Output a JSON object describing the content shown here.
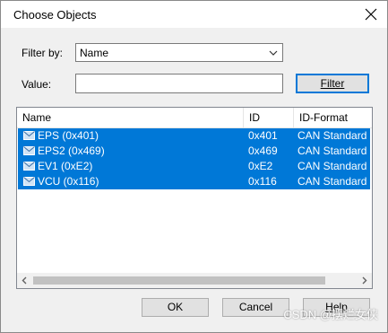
{
  "dialog": {
    "title": "Choose Objects",
    "close_icon": "close-icon"
  },
  "filter": {
    "filter_by_label": "Filter by:",
    "filter_by_value": "Name",
    "value_label": "Value:",
    "value_text": "",
    "filter_button": "Filter"
  },
  "table": {
    "columns": [
      "Name",
      "ID",
      "ID-Format"
    ],
    "rows": [
      {
        "name": "EPS (0x401)",
        "id": "0x401",
        "format": "CAN Standard",
        "icon": "message-icon"
      },
      {
        "name": "EPS2 (0x469)",
        "id": "0x469",
        "format": "CAN Standard",
        "icon": "message-icon"
      },
      {
        "name": "EV1 (0xE2)",
        "id": "0xE2",
        "format": "CAN Standard",
        "icon": "message-icon"
      },
      {
        "name": "VCU (0x116)",
        "id": "0x116",
        "format": "CAN Standard",
        "icon": "message-icon"
      }
    ],
    "selection_color": "#0078d7"
  },
  "buttons": {
    "ok": "OK",
    "cancel": "Cancel",
    "help": "Help"
  },
  "watermark": "CSDN @摆烂女侠"
}
